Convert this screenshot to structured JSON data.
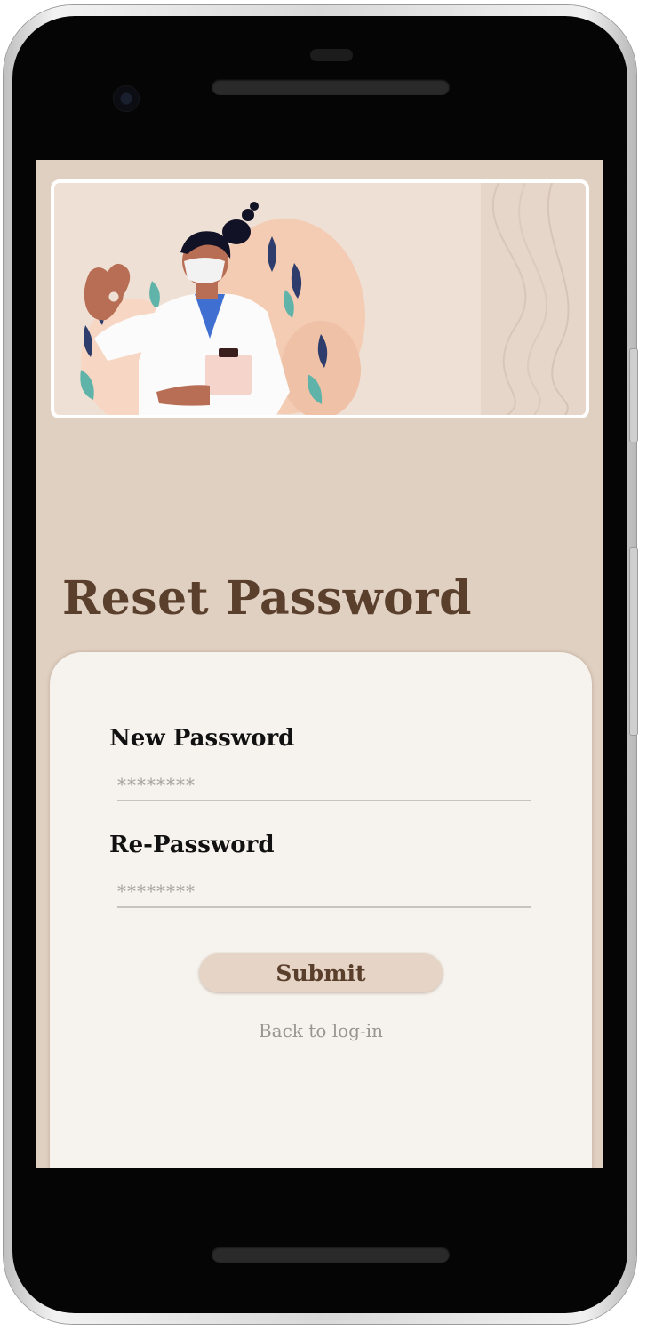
{
  "screen": {
    "title": "Reset Password",
    "banner": {
      "illustration": "doctor-ok-gesture-illustration"
    },
    "form": {
      "new_password_label": "New Password",
      "new_password_placeholder": "********",
      "re_password_label": "Re-Password",
      "re_password_placeholder": "********",
      "submit_label": "Submit",
      "back_link": "Back to log-in"
    }
  },
  "colors": {
    "screen_bg": "#e0d0c1",
    "title": "#5b3f2d",
    "card_bg": "#f6f2ed",
    "button_bg": "#e6d5c7",
    "link": "#9a9590"
  }
}
